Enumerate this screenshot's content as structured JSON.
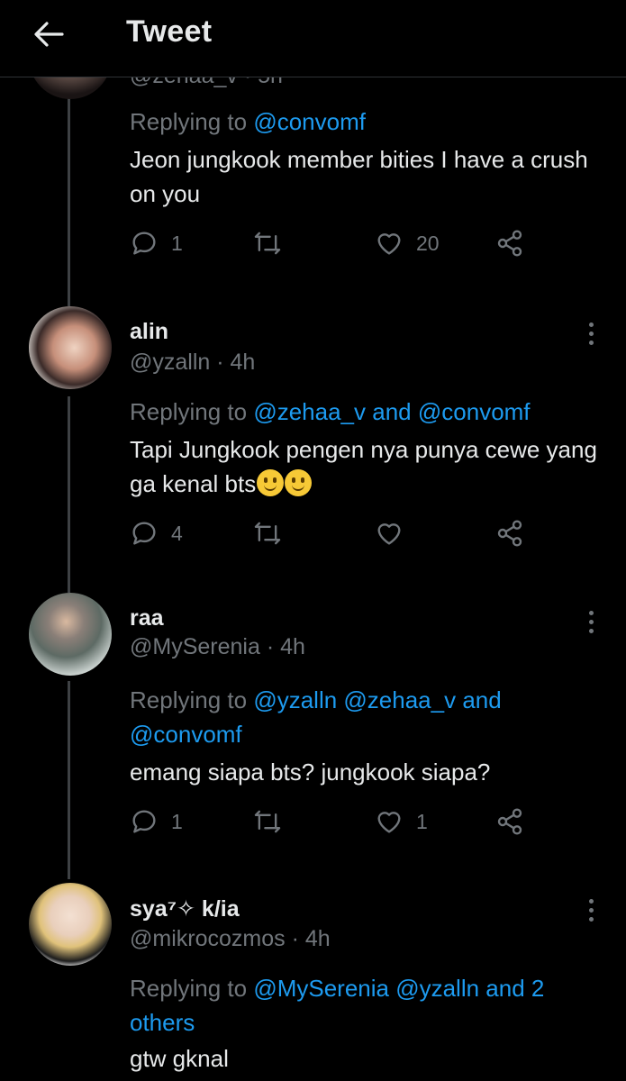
{
  "header": {
    "title": "Tweet"
  },
  "tweets": [
    {
      "handle_time_partial": "@zehaa_v · 5h",
      "replying_label": "Replying to",
      "mentions": [
        "@convomf"
      ],
      "text": "Jeon jungkook member bities I have a crush on you",
      "reply_count": "1",
      "retweet_count": "",
      "like_count": "20"
    },
    {
      "name": "alin",
      "handle": "@yzalln",
      "time": "4h",
      "replying_label": "Replying to",
      "mentions": [
        "@zehaa_v",
        "and",
        "@convomf"
      ],
      "text": "Tapi Jungkook pengen nya punya cewe yang ga kenal bts",
      "reply_count": "4",
      "retweet_count": "",
      "like_count": ""
    },
    {
      "name": "raa",
      "handle": "@MySerenia",
      "time": "4h",
      "replying_label": "Replying to",
      "mentions": [
        "@yzalln @zehaa_v and",
        "@convomf"
      ],
      "text": "emang siapa bts? jungkook siapa?",
      "reply_count": "1",
      "retweet_count": "",
      "like_count": "1"
    },
    {
      "name": "sya⁷✧ k/ia",
      "handle": "@mikrocozmos",
      "time": "4h",
      "replying_label": "Replying to",
      "mentions": [
        "@MySerenia @yzalln and 2",
        "others"
      ],
      "text": "gtw gknal"
    }
  ],
  "colors": {
    "accent": "#1d9bf0",
    "muted": "#71767b",
    "text": "#e7e9ea",
    "background": "#000000"
  }
}
